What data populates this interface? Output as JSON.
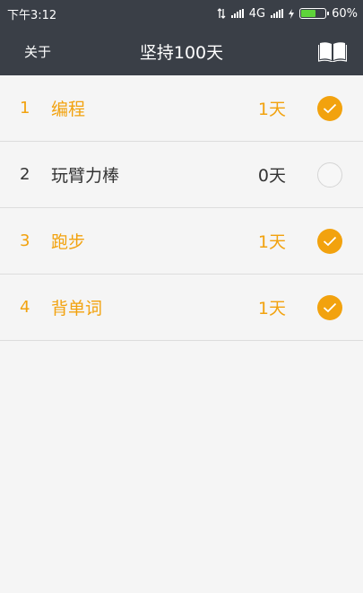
{
  "status_bar": {
    "time": "下午3:12",
    "network": "4G",
    "battery": "60%",
    "battery_level": 0.6
  },
  "app_bar": {
    "about_label": "关于",
    "title": "坚持100天",
    "book_icon": "book-icon"
  },
  "colors": {
    "header_bg": "#3a3f47",
    "accent": "#f2a20e",
    "background": "#f5f5f5"
  },
  "tasks": [
    {
      "index": "1",
      "name": "编程",
      "days": "1天",
      "checked": true
    },
    {
      "index": "2",
      "name": "玩臂力棒",
      "days": "0天",
      "checked": false
    },
    {
      "index": "3",
      "name": "跑步",
      "days": "1天",
      "checked": true
    },
    {
      "index": "4",
      "name": "背单词",
      "days": "1天",
      "checked": true
    }
  ]
}
